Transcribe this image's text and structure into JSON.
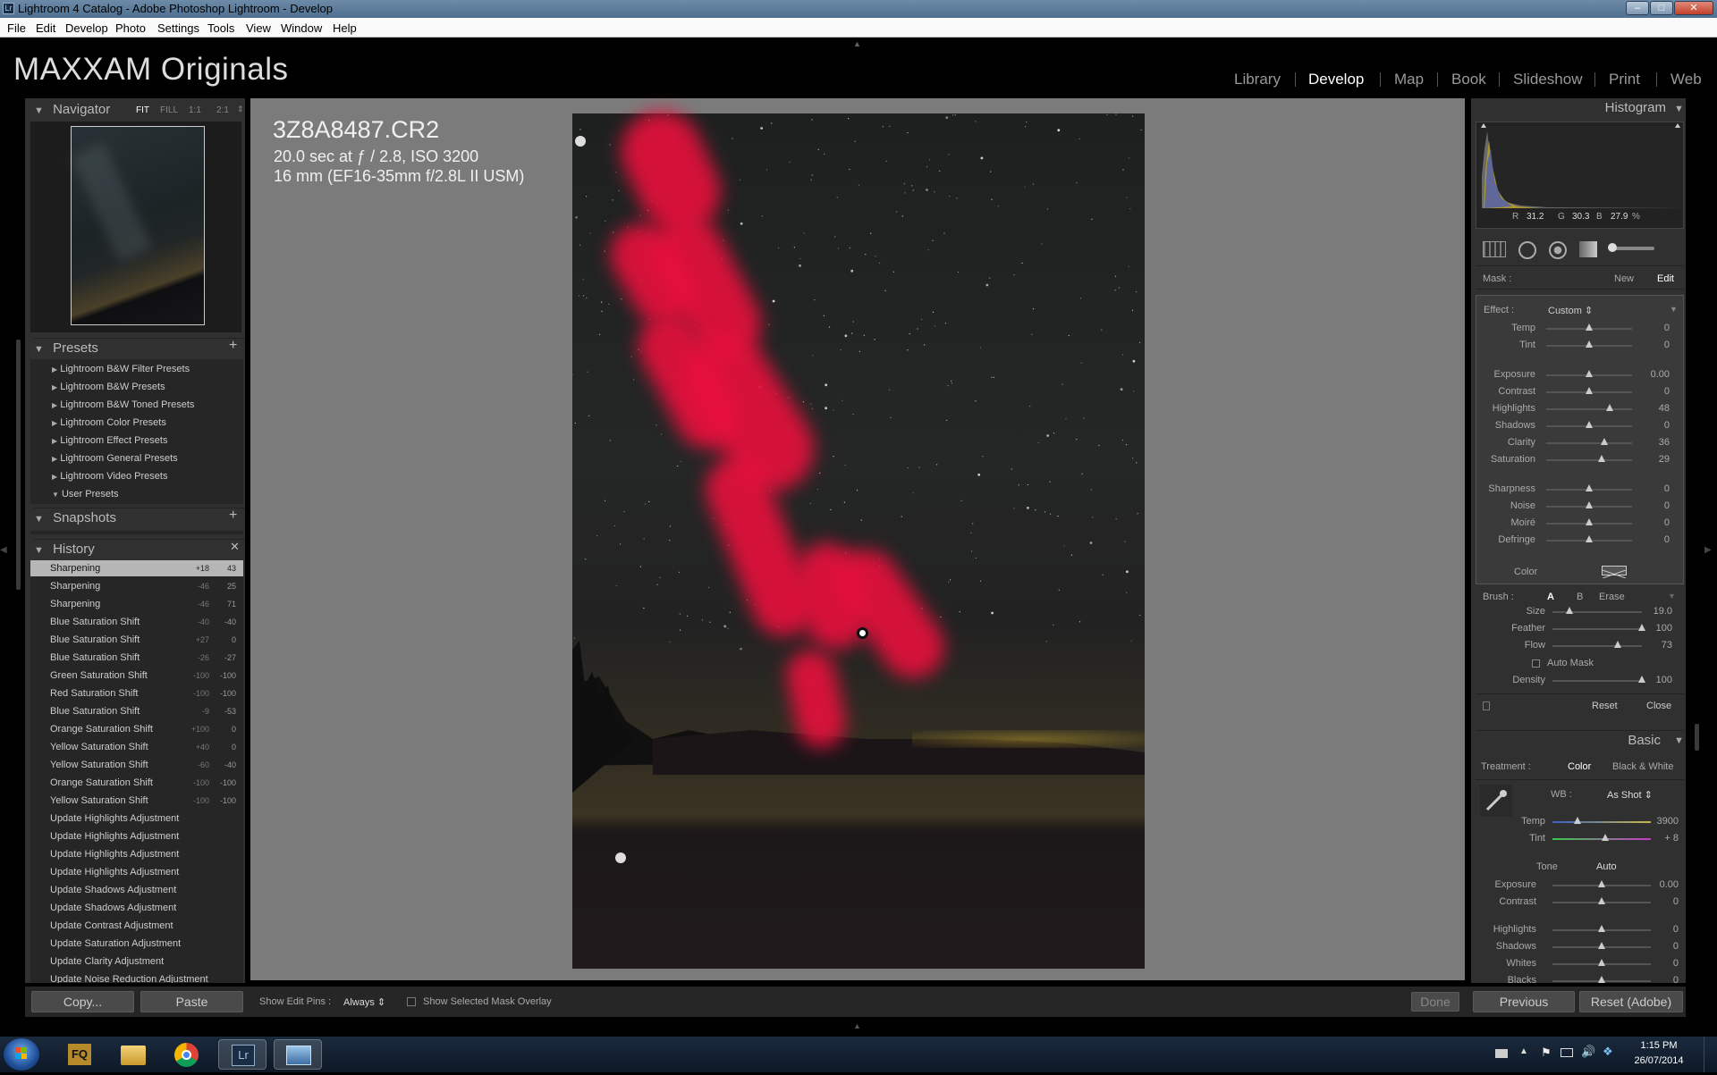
{
  "window": {
    "title": "Lightroom 4 Catalog - Adobe Photoshop Lightroom - Develop"
  },
  "menu": [
    "File",
    "Edit",
    "Develop",
    "Photo",
    "Settings",
    "Tools",
    "View",
    "Window",
    "Help"
  ],
  "identity_plate": "MAXXAM Originals",
  "modules": [
    "Library",
    "Develop",
    "Map",
    "Book",
    "Slideshow",
    "Print",
    "Web"
  ],
  "active_module": "Develop",
  "navigator": {
    "title": "Navigator",
    "zoom": [
      "FIT",
      "FILL",
      "1:1",
      "2:1"
    ]
  },
  "presets": {
    "title": "Presets",
    "items": [
      "Lightroom B&W Filter Presets",
      "Lightroom B&W Presets",
      "Lightroom B&W Toned Presets",
      "Lightroom Color Presets",
      "Lightroom Effect Presets",
      "Lightroom General Presets",
      "Lightroom Video Presets",
      "User Presets"
    ]
  },
  "snapshots": {
    "title": "Snapshots"
  },
  "history": {
    "title": "History",
    "items": [
      {
        "name": "Sharpening",
        "a": "+18",
        "b": "43"
      },
      {
        "name": "Sharpening",
        "a": "-46",
        "b": "25"
      },
      {
        "name": "Sharpening",
        "a": "-46",
        "b": "71"
      },
      {
        "name": "Blue Saturation Shift",
        "a": "-40",
        "b": "-40"
      },
      {
        "name": "Blue Saturation Shift",
        "a": "+27",
        "b": "0"
      },
      {
        "name": "Blue Saturation Shift",
        "a": "-26",
        "b": "-27"
      },
      {
        "name": "Green Saturation Shift",
        "a": "-100",
        "b": "-100"
      },
      {
        "name": "Red Saturation Shift",
        "a": "-100",
        "b": "-100"
      },
      {
        "name": "Blue Saturation Shift",
        "a": "-9",
        "b": "-53"
      },
      {
        "name": "Orange Saturation Shift",
        "a": "+100",
        "b": "0"
      },
      {
        "name": "Yellow Saturation Shift",
        "a": "+40",
        "b": "0"
      },
      {
        "name": "Yellow Saturation Shift",
        "a": "-60",
        "b": "-40"
      },
      {
        "name": "Orange Saturation Shift",
        "a": "-100",
        "b": "-100"
      },
      {
        "name": "Yellow Saturation Shift",
        "a": "-100",
        "b": "-100"
      },
      {
        "name": "Update Highlights Adjustment",
        "a": "",
        "b": ""
      },
      {
        "name": "Update Highlights Adjustment",
        "a": "",
        "b": ""
      },
      {
        "name": "Update Highlights Adjustment",
        "a": "",
        "b": ""
      },
      {
        "name": "Update Highlights Adjustment",
        "a": "",
        "b": ""
      },
      {
        "name": "Update Shadows Adjustment",
        "a": "",
        "b": ""
      },
      {
        "name": "Update Shadows Adjustment",
        "a": "",
        "b": ""
      },
      {
        "name": "Update Contrast Adjustment",
        "a": "",
        "b": ""
      },
      {
        "name": "Update Saturation Adjustment",
        "a": "",
        "b": ""
      },
      {
        "name": "Update Clarity Adjustment",
        "a": "",
        "b": ""
      },
      {
        "name": "Update Noise Reduction Adjustment",
        "a": "",
        "b": ""
      }
    ]
  },
  "info": {
    "filename": "3Z8A8487.CR2",
    "exposure": "20.0 sec at ƒ / 2.8, ISO 3200",
    "lens": "16 mm (EF16-35mm f/2.8L II USM)"
  },
  "histogram": {
    "title": "Histogram",
    "r_label": "R",
    "r": "31.2",
    "g_label": "G",
    "g": "30.3",
    "b_label": "B",
    "b": "27.9",
    "pct": "%"
  },
  "mask": {
    "label": "Mask :",
    "new": "New",
    "edit": "Edit"
  },
  "effect": {
    "label": "Effect :",
    "value": "Custom",
    "sliders": [
      {
        "label": "Temp",
        "value": "0",
        "pos": 0.5
      },
      {
        "label": "Tint",
        "value": "0",
        "pos": 0.5
      },
      {
        "label": "Exposure",
        "value": "0.00",
        "pos": 0.5
      },
      {
        "label": "Contrast",
        "value": "0",
        "pos": 0.5
      },
      {
        "label": "Highlights",
        "value": "48",
        "pos": 0.74
      },
      {
        "label": "Shadows",
        "value": "0",
        "pos": 0.5
      },
      {
        "label": "Clarity",
        "value": "36",
        "pos": 0.68
      },
      {
        "label": "Saturation",
        "value": "29",
        "pos": 0.645
      },
      {
        "label": "Sharpness",
        "value": "0",
        "pos": 0.5
      },
      {
        "label": "Noise",
        "value": "0",
        "pos": 0.5
      },
      {
        "label": "Moiré",
        "value": "0",
        "pos": 0.5
      },
      {
        "label": "Defringe",
        "value": "0",
        "pos": 0.5
      }
    ],
    "color_label": "Color"
  },
  "brush": {
    "label": "Brush :",
    "a": "A",
    "b": "B",
    "erase": "Erase",
    "sliders": [
      {
        "label": "Size",
        "value": "19.0",
        "pos": 0.19
      },
      {
        "label": "Feather",
        "value": "100",
        "pos": 1.0
      },
      {
        "label": "Flow",
        "value": "73",
        "pos": 0.73
      }
    ],
    "automask": "Auto Mask",
    "density": {
      "label": "Density",
      "value": "100",
      "pos": 1.0
    },
    "reset": "Reset",
    "close": "Close"
  },
  "basic": {
    "title": "Basic",
    "treatment": "Treatment :",
    "color": "Color",
    "bw": "Black & White",
    "wb": "WB :",
    "wb_value": "As Shot",
    "temp": {
      "label": "Temp",
      "value": "3900",
      "pos": 0.25
    },
    "tint": {
      "label": "Tint",
      "value": "+ 8",
      "pos": 0.54
    },
    "tone": "Tone",
    "auto": "Auto",
    "sliders": [
      {
        "label": "Exposure",
        "value": "0.00",
        "pos": 0.5
      },
      {
        "label": "Contrast",
        "value": "0",
        "pos": 0.5
      },
      {
        "label": "Highlights",
        "value": "0",
        "pos": 0.5
      },
      {
        "label": "Shadows",
        "value": "0",
        "pos": 0.5
      },
      {
        "label": "Whites",
        "value": "0",
        "pos": 0.5
      },
      {
        "label": "Blacks",
        "value": "0",
        "pos": 0.5
      }
    ]
  },
  "toolbar": {
    "copy": "Copy...",
    "paste": "Paste",
    "show_pins_label": "Show Edit Pins :",
    "show_pins_value": "Always",
    "overlay": "Show Selected Mask Overlay",
    "done": "Done",
    "previous": "Previous",
    "reset_adobe": "Reset (Adobe)"
  },
  "tray": {
    "time": "1:15 PM",
    "date": "26/07/2014"
  }
}
